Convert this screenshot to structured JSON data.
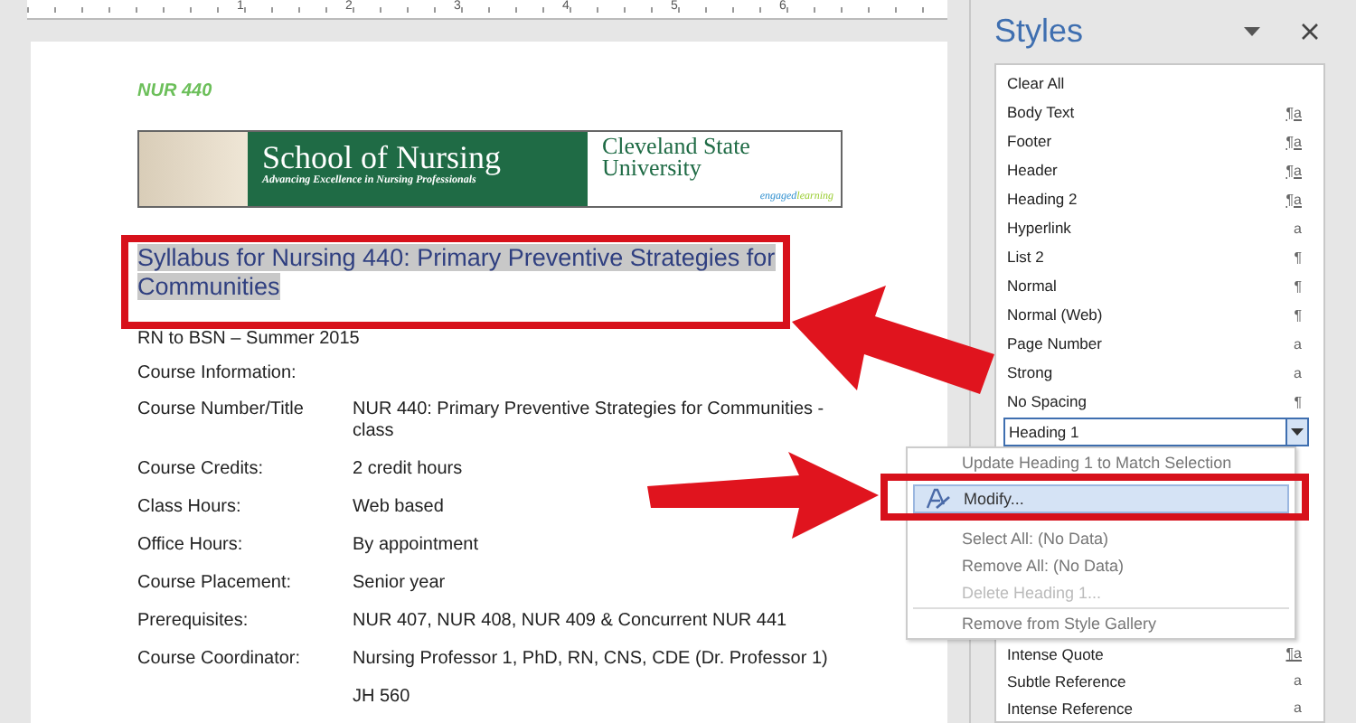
{
  "ruler": {
    "numbers": [
      "1",
      "2",
      "3",
      "4",
      "5",
      "6"
    ]
  },
  "document": {
    "course_code": "NUR 440",
    "banner": {
      "title": "School of Nursing",
      "tagline": "Advancing Excellence in Nursing Professionals",
      "university": "Cleveland State University",
      "slogan_first": "engaged",
      "slogan_second": "learning"
    },
    "heading": "Syllabus for Nursing 440: Primary Preventive Strategies for Communities",
    "heading_selected": true,
    "subtitle": "RN to BSN – Summer 2015",
    "section_label": "Course Information:",
    "rows": [
      {
        "label": "Course Number/Title",
        "value": "NUR 440: Primary Preventive Strategies for Communities - class"
      },
      {
        "label": "Course Credits:",
        "value": "2 credit hours"
      },
      {
        "label": "Class Hours:",
        "value": "Web based"
      },
      {
        "label": "Office Hours:",
        "value": "By appointment"
      },
      {
        "label": "Course Placement:",
        "value": "Senior year"
      },
      {
        "label": "Prerequisites:",
        "value": "NUR 407, NUR 408, NUR 409 & Concurrent NUR 441"
      },
      {
        "label": "Course Coordinator:",
        "value": "Nursing Professor 1, PhD, RN, CNS, CDE (Dr. Professor 1)"
      },
      {
        "label": "",
        "value": "JH 560"
      }
    ]
  },
  "styles_pane": {
    "title": "Styles",
    "items": [
      {
        "name": "Clear All",
        "kind": "none"
      },
      {
        "name": "Body Text",
        "kind": "linked",
        "symbol": "¶a"
      },
      {
        "name": "Footer",
        "kind": "linked",
        "symbol": "¶a"
      },
      {
        "name": "Header",
        "kind": "linked",
        "symbol": "¶a"
      },
      {
        "name": "Heading 2",
        "kind": "linked",
        "symbol": "¶a"
      },
      {
        "name": "Hyperlink",
        "kind": "character",
        "symbol": "a"
      },
      {
        "name": "List 2",
        "kind": "paragraph",
        "symbol": "¶"
      },
      {
        "name": "Normal",
        "kind": "paragraph",
        "symbol": "¶"
      },
      {
        "name": "Normal (Web)",
        "kind": "paragraph",
        "symbol": "¶"
      },
      {
        "name": "Page Number",
        "kind": "character",
        "symbol": "a"
      },
      {
        "name": "Strong",
        "kind": "character",
        "symbol": "a"
      },
      {
        "name": "No Spacing",
        "kind": "paragraph",
        "symbol": "¶"
      }
    ],
    "current": "Heading 1",
    "items_after": [
      {
        "name": "Intense Quote",
        "kind": "linked",
        "symbol": "¶a"
      },
      {
        "name": "Subtle Reference",
        "kind": "character",
        "symbol": "a"
      },
      {
        "name": "Intense Reference",
        "kind": "character",
        "symbol": "a"
      }
    ],
    "menu": [
      {
        "label": "Update Heading 1 to Match Selection",
        "selected": false,
        "disabled": false,
        "icon": false,
        "separator_before": false
      },
      {
        "label": "Modify...",
        "selected": true,
        "disabled": false,
        "icon": true,
        "separator_before": false
      },
      {
        "label": "Select All: (No Data)",
        "selected": false,
        "disabled": false,
        "icon": false,
        "separator_before": false
      },
      {
        "label": "Remove All: (No Data)",
        "selected": false,
        "disabled": false,
        "icon": false,
        "separator_before": false
      },
      {
        "label": "Delete Heading 1...",
        "selected": false,
        "disabled": true,
        "icon": false,
        "separator_before": false
      },
      {
        "label": "Remove from Style Gallery",
        "selected": false,
        "disabled": false,
        "icon": false,
        "separator_before": true
      }
    ]
  }
}
